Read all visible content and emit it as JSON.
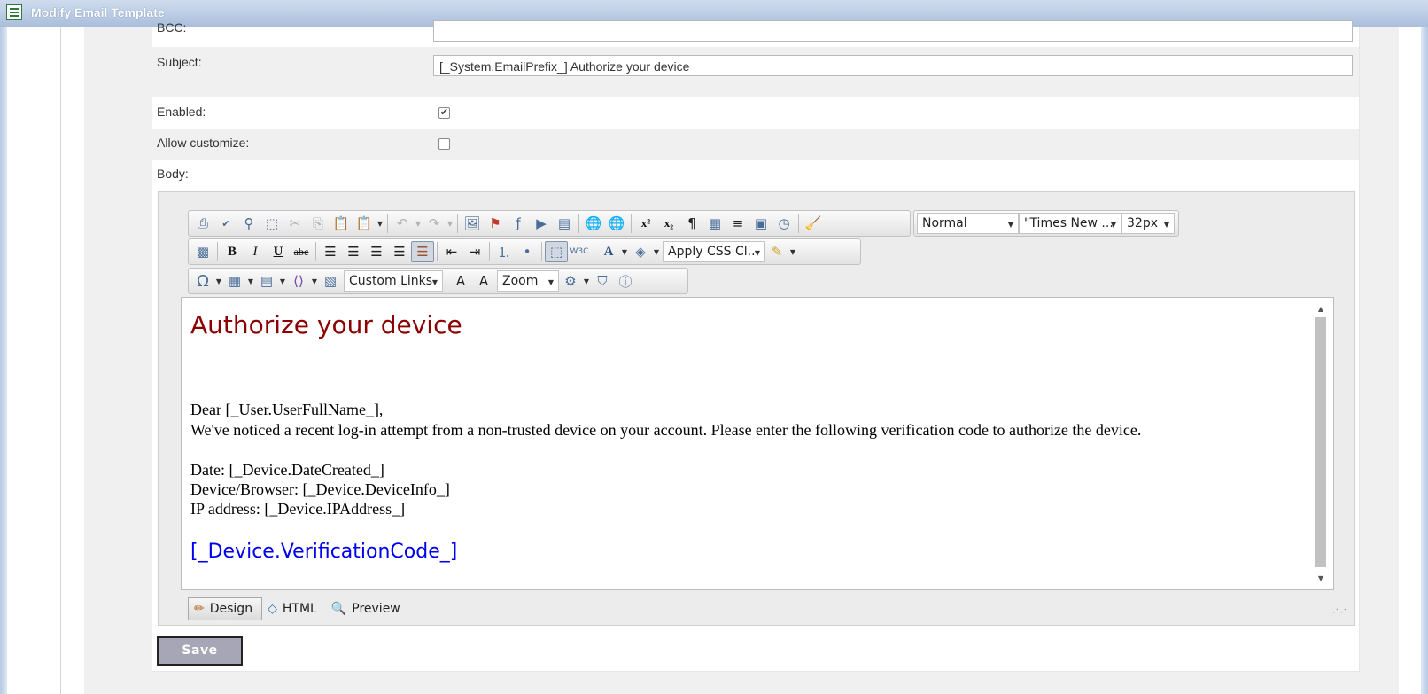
{
  "window": {
    "title": "Modify Email Template"
  },
  "form": {
    "bcc_label": "BCC:",
    "bcc_value": "",
    "subject_label": "Subject:",
    "subject_value": "[_System.EmailPrefix_] Authorize your device",
    "enabled_label": "Enabled:",
    "enabled_checked": true,
    "allow_customize_label": "Allow customize:",
    "allow_customize_checked": false,
    "body_label": "Body:",
    "save_label": "Save"
  },
  "toolbar": {
    "paragraph_style": "Normal",
    "font_name": "\"Times New ...",
    "font_size": "32px",
    "css_class": "Apply CSS Cl...",
    "custom_links": "Custom Links",
    "zoom": "Zoom",
    "icons_row1": [
      "print-icon",
      "spellcheck-icon",
      "find-replace-icon",
      "select-all-icon",
      "cut-icon",
      "copy-icon",
      "paste-icon",
      "paste-options-icon",
      "undo-icon",
      "redo-icon",
      "image-manager-icon",
      "image-map-icon",
      "flash-manager-icon",
      "media-manager-icon",
      "document-manager-icon",
      "hyperlink-icon",
      "remove-link-icon",
      "superscript-icon",
      "subscript-icon",
      "paragraph-icon",
      "paste-plain-text-icon",
      "align-icon",
      "template-manager-icon",
      "insert-date-icon",
      "format-stripper-icon"
    ],
    "icons_row2": [
      "set-image-properties-icon",
      "bold-icon",
      "italic-icon",
      "underline-icon",
      "strikethrough-icon",
      "justify-left-icon",
      "justify-center-icon",
      "justify-right-icon",
      "justify-full-icon",
      "justify-none-icon",
      "outdent-icon",
      "indent-icon",
      "ordered-list-icon",
      "unordered-list-icon",
      "toggle-borders-icon",
      "xhtml-validator-icon",
      "fore-color-icon",
      "back-color-icon",
      "format-painter-icon"
    ],
    "icons_row3": [
      "special-character-icon",
      "insert-table-icon",
      "table-wizard-icon",
      "insert-snippet-icon",
      "image-properties-icon",
      "font-size-up-icon",
      "font-size-down-icon",
      "module-manager-icon",
      "track-changes-icon",
      "about-icon"
    ]
  },
  "editor": {
    "heading": "Authorize your device",
    "greeting": "Dear [_User.UserFullName_],",
    "message": "We've noticed a recent log-in attempt from a non-trusted device on your account. Please enter the following verification code to authorize the device.",
    "date_line": "Date: [_Device.DateCreated_]",
    "device_line": "Device/Browser: [_Device.DeviceInfo_]",
    "ip_line": "IP address: [_Device.IPAddress_]",
    "verification_code": "[_Device.VerificationCode_]",
    "heading_color": "#8b0000",
    "code_color": "#0000ee"
  },
  "modes": {
    "design": "Design",
    "html": "HTML",
    "preview": "Preview",
    "active": "design"
  },
  "colors": {
    "titlebar": "#aabfdc",
    "save_button": "#a6a6b6"
  }
}
